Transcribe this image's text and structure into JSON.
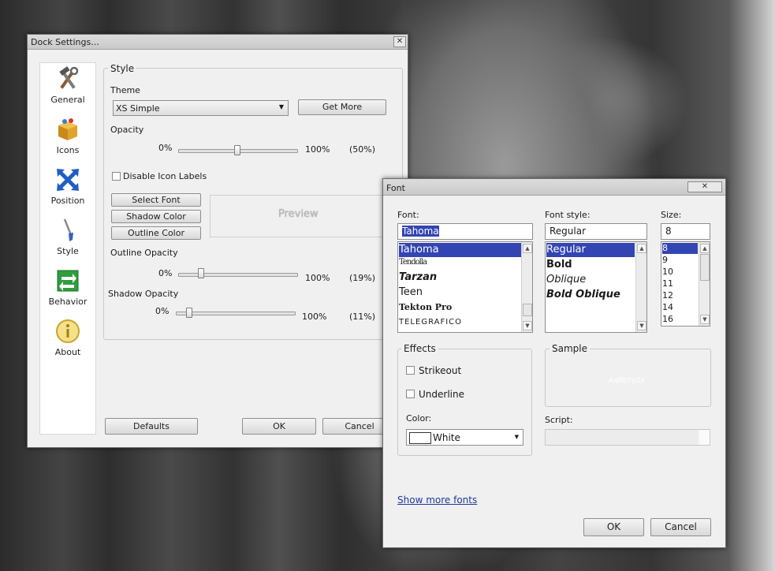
{
  "dock": {
    "title": "Dock Settings...",
    "close_glyph": "✕",
    "sidebar": [
      {
        "label": "General",
        "icon": "tools-icon"
      },
      {
        "label": "Icons",
        "icon": "package-icon"
      },
      {
        "label": "Position",
        "icon": "arrows-icon"
      },
      {
        "label": "Style",
        "icon": "paintbrush-icon"
      },
      {
        "label": "Behavior",
        "icon": "behavior-icon"
      },
      {
        "label": "About",
        "icon": "info-icon"
      }
    ],
    "style_group": "Style",
    "theme_label": "Theme",
    "theme_value": "XS Simple",
    "get_more": "Get More",
    "opacity_label": "Opacity",
    "opacity": {
      "min": "0%",
      "max": "100%",
      "value_text": "(50%)",
      "value": 0.5
    },
    "disable_labels": "Disable Icon Labels",
    "select_font": "Select Font",
    "shadow_color": "Shadow Color",
    "outline_color": "Outline Color",
    "preview": "Preview",
    "outline_opacity_label": "Outline Opacity",
    "outline_opacity": {
      "min": "0%",
      "max": "100%",
      "value_text": "(19%)",
      "value": 0.19
    },
    "shadow_opacity_label": "Shadow Opacity",
    "shadow_opacity": {
      "min": "0%",
      "max": "100%",
      "value_text": "(11%)",
      "value": 0.11
    },
    "defaults": "Defaults",
    "ok": "OK",
    "cancel": "Cancel"
  },
  "font": {
    "title": "Font",
    "close_glyph": "✕",
    "font_label": "Font:",
    "font_value": "Tahoma",
    "fonts": [
      "Tahoma",
      "Tendolla",
      "Tarzan",
      "Teen",
      "Tekton Pro",
      "TELEGRAFICO"
    ],
    "style_label": "Font style:",
    "style_value": "Regular",
    "styles": [
      "Regular",
      "Bold",
      "Oblique",
      "Bold Oblique"
    ],
    "size_label": "Size:",
    "size_value": "8",
    "sizes": [
      "8",
      "9",
      "10",
      "11",
      "12",
      "14",
      "16"
    ],
    "effects_label": "Effects",
    "strikeout": "Strikeout",
    "underline": "Underline",
    "color_label": "Color:",
    "color_value": "White",
    "sample_label": "Sample",
    "sample_text": "AaBbYyZz",
    "script_label": "Script:",
    "show_more": "Show more fonts",
    "ok": "OK",
    "cancel": "Cancel"
  },
  "colors": {
    "selection": "#3345b3",
    "window_bg": "#f0f0f0",
    "link": "#1d3a9e"
  }
}
